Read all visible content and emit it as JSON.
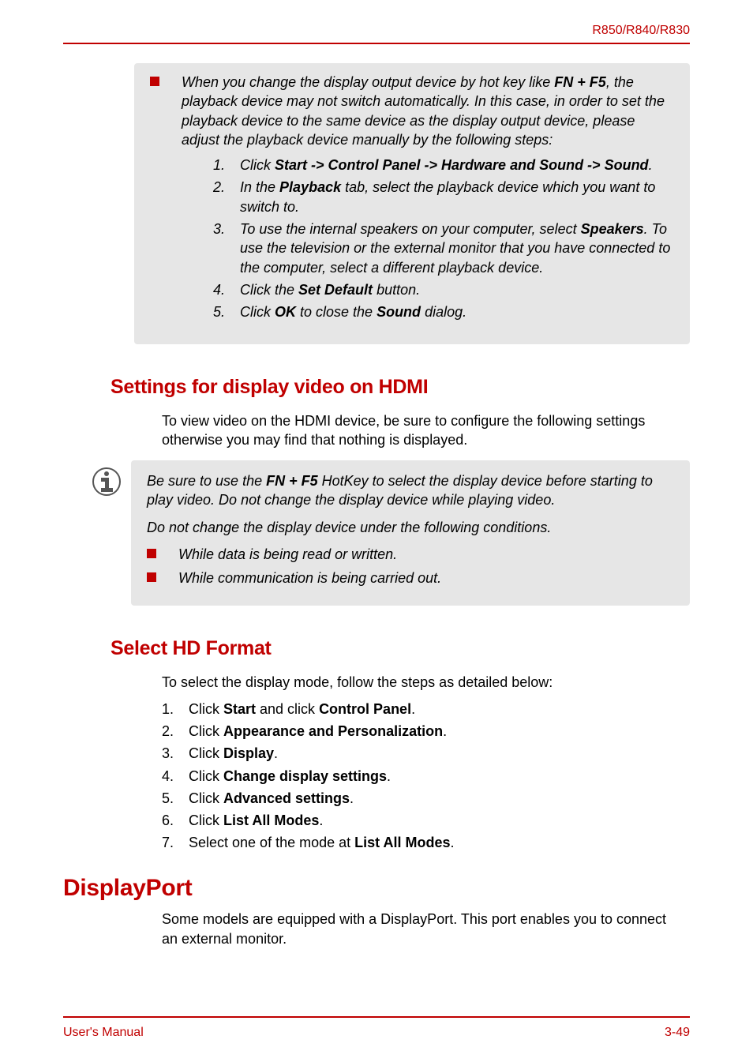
{
  "header": {
    "model": "R850/R840/R830"
  },
  "box1": {
    "intro_pre": "When you change the display output device by hot key like ",
    "intro_hotkey": "FN + F5",
    "intro_post": ", the playback device may not switch automatically. In this case, in order to set the playback device to the same device as the display output device, please adjust the playback device manually by the following steps:",
    "steps": [
      {
        "n": "1.",
        "pre": "Click ",
        "bold": "Start -> Control Panel -> Hardware and Sound -> Sound",
        "post": "."
      },
      {
        "n": "2.",
        "pre": "In the ",
        "bold": "Playback",
        "post": " tab, select the playback device which you want to switch to."
      },
      {
        "n": "3.",
        "pre": "To use the internal speakers on your computer, select ",
        "bold": "Speakers",
        "post": ". To use the television or the external monitor that you have connected to the computer, select a different playback device."
      },
      {
        "n": "4.",
        "pre": "Click the ",
        "bold": "Set Default",
        "post": " button."
      },
      {
        "n": "5.",
        "pre": "Click ",
        "bold": "OK",
        "mid": " to close the ",
        "bold2": "Sound",
        "post": " dialog."
      }
    ]
  },
  "section1": {
    "heading": "Settings for display video on HDMI",
    "para": "To view video on the HDMI device, be sure to configure the following settings otherwise you may find that nothing is displayed."
  },
  "box2": {
    "p1_pre": "Be sure to use the ",
    "p1_bold": "FN + F5",
    "p1_post": " HotKey to select the display device before starting to play video. Do not change the display device while playing video.",
    "p2": "Do not change the display device under the following conditions.",
    "b1": "While data is being read or written.",
    "b2": "While communication is being carried out."
  },
  "section2": {
    "heading": "Select HD Format",
    "para": "To select the display mode, follow the steps as detailed below:",
    "steps": [
      {
        "n": "1.",
        "pre": "Click ",
        "bold": "Start",
        "mid": " and click ",
        "bold2": "Control Panel",
        "post": "."
      },
      {
        "n": "2.",
        "pre": "Click ",
        "bold": "Appearance and Personalization",
        "post": "."
      },
      {
        "n": "3.",
        "pre": "Click ",
        "bold": "Display",
        "post": "."
      },
      {
        "n": "4.",
        "pre": "Click ",
        "bold": "Change display settings",
        "post": "."
      },
      {
        "n": "5.",
        "pre": "Click ",
        "bold": "Advanced settings",
        "post": "."
      },
      {
        "n": "6.",
        "pre": "Click ",
        "bold": "List All Modes",
        "post": "."
      },
      {
        "n": "7.",
        "pre": "Select one of the mode at ",
        "bold": "List All Modes",
        "post": "."
      }
    ]
  },
  "section3": {
    "heading": "DisplayPort",
    "para": "Some models are equipped with a DisplayPort. This port enables you to connect an external monitor."
  },
  "footer": {
    "left": "User's Manual",
    "right": "3-49"
  }
}
